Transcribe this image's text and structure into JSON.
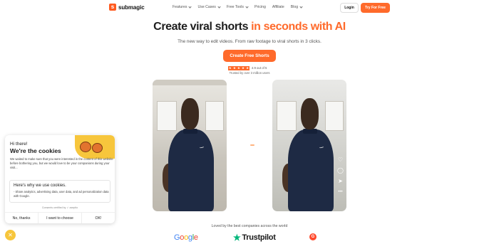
{
  "nav": {
    "logo_text": "submagic",
    "logo_mark": "s",
    "menu": [
      {
        "label": "Features",
        "has_dropdown": true
      },
      {
        "label": "Use Cases",
        "has_dropdown": true
      },
      {
        "label": "Free Tools",
        "has_dropdown": true
      },
      {
        "label": "Pricing",
        "has_dropdown": false
      },
      {
        "label": "Affiliate",
        "has_dropdown": false
      },
      {
        "label": "Blog",
        "has_dropdown": true
      }
    ],
    "login_label": "Login",
    "try_label": "Try For Free"
  },
  "hero": {
    "title_plain": "Create viral shorts",
    "title_accent": "in seconds with AI",
    "subtitle": "The new way to edit videos. From raw footage to viral shorts in 3 clicks.",
    "cta_label": "Create Free Shorts",
    "rating_text": "4.9 out of 5",
    "rating_stars": 5,
    "trusted_text": "Trusted by over 3 million users"
  },
  "loved": {
    "heading": "Loved by the best companies across the world",
    "brands": [
      "Google",
      "Trustpilot",
      "G"
    ]
  },
  "cookie": {
    "hi": "Hi there!",
    "title": "We're the cookies",
    "description": "We waited to make sure that you were interested in the content of this website before bothering you, but we would love to be your companions during your visit...",
    "box_title": "Here's why we use cookies.",
    "box_text": "- Share analytics, advertising data, user data, and ad personalization data with Google.",
    "certified": "Consents certified by ✓ axeptio",
    "buttons": {
      "no": "No, thanks",
      "choose": "I want to choose",
      "ok": "OK!"
    }
  },
  "colors": {
    "accent": "#ff6a2b",
    "cookie_yellow": "#f7c63c",
    "trustpilot_green": "#00b67a"
  },
  "icons": [
    "heart-icon",
    "comment-icon",
    "share-icon",
    "more-icon",
    "cookie-icon"
  ]
}
